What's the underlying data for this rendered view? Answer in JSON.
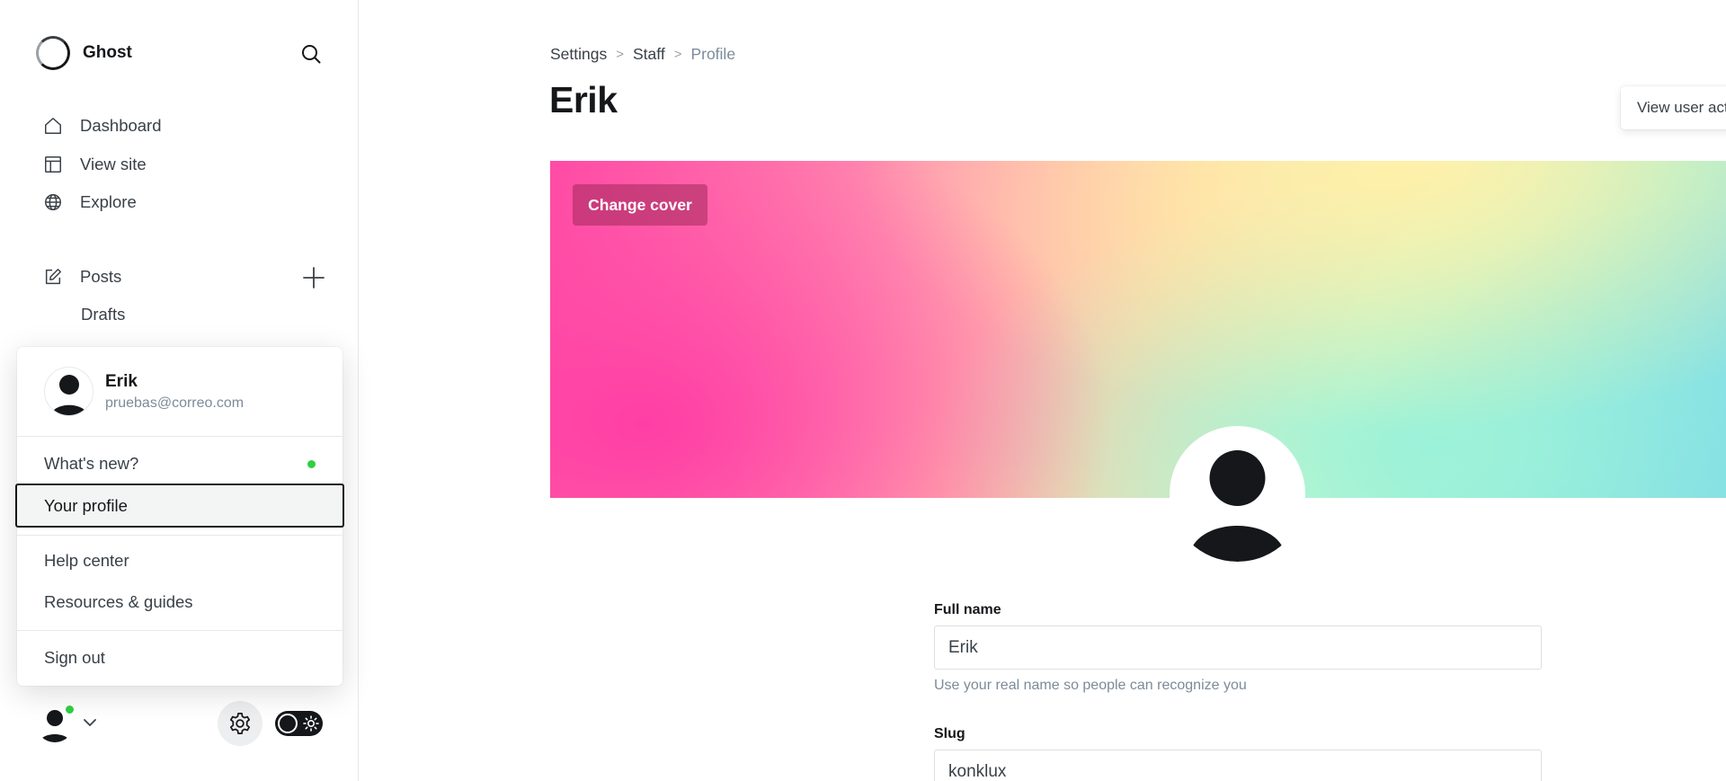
{
  "brand": {
    "name": "Ghost"
  },
  "nav": {
    "dashboard": "Dashboard",
    "view_site": "View site",
    "explore": "Explore",
    "posts": "Posts",
    "drafts": "Drafts"
  },
  "user_menu": {
    "name": "Erik",
    "email": "pruebas@correo.com",
    "items": {
      "whats_new": "What's new?",
      "your_profile": "Your profile",
      "help_center": "Help center",
      "resources": "Resources & guides",
      "sign_out": "Sign out"
    }
  },
  "breadcrumb": {
    "settings": "Settings",
    "staff": "Staff",
    "profile": "Profile"
  },
  "page": {
    "title": "Erik",
    "view_activity": "View user activity"
  },
  "cover": {
    "change_label": "Change cover"
  },
  "form": {
    "full_name": {
      "label": "Full name",
      "value": "Erik",
      "hint": "Use your real name so people can recognize you"
    },
    "slug": {
      "label": "Slug",
      "value": "konklux"
    }
  },
  "colors": {
    "accent_green": "#30cf43",
    "text_dark": "#15171a",
    "text_muted": "#7c8b9a"
  },
  "icons": [
    "search-icon",
    "home-icon",
    "layout-icon",
    "globe-icon",
    "edit-icon",
    "plus-icon",
    "user-icon",
    "chevron-down-icon",
    "gear-icon",
    "sun-icon"
  ]
}
